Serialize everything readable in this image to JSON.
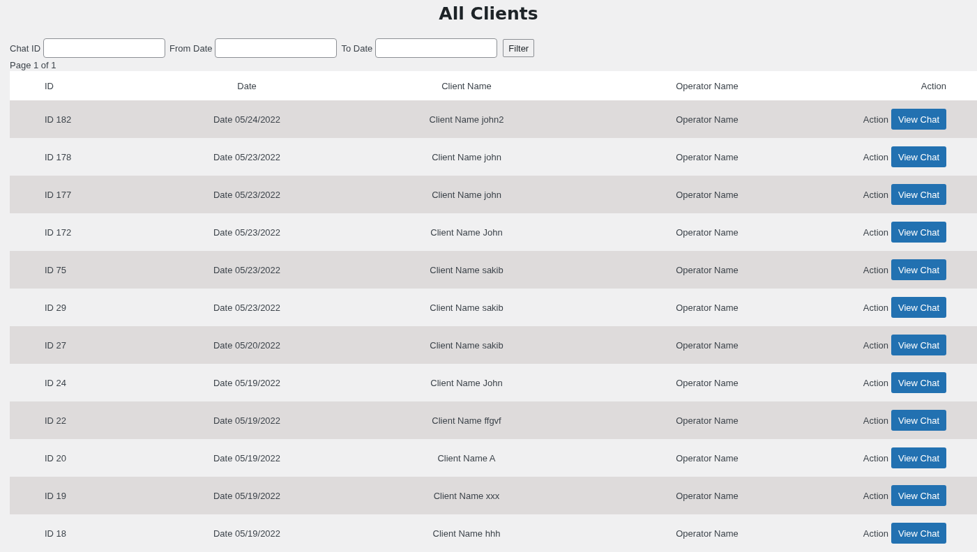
{
  "title": "All Clients",
  "filters": [
    {
      "label": "Chat ID"
    },
    {
      "label": "From Date"
    },
    {
      "label": "To Date"
    }
  ],
  "filter_button": "Filter",
  "page_info": "Page 1 of 1",
  "table": {
    "columns": [
      "ID",
      "Date",
      "Client Name",
      "Operator Name",
      "Action"
    ],
    "rows": [
      {
        "id": "ID 182",
        "date": "Date 05/24/2022",
        "client": "Client Name john2",
        "operator": "Operator Name",
        "action_label": "Action",
        "button": "View Chat"
      },
      {
        "id": "ID 178",
        "date": "Date 05/23/2022",
        "client": "Client Name john",
        "operator": "Operator Name",
        "action_label": "Action",
        "button": "View Chat"
      },
      {
        "id": "ID 177",
        "date": "Date 05/23/2022",
        "client": "Client Name john",
        "operator": "Operator Name",
        "action_label": "Action",
        "button": "View Chat"
      },
      {
        "id": "ID 172",
        "date": "Date 05/23/2022",
        "client": "Client Name John",
        "operator": "Operator Name",
        "action_label": "Action",
        "button": "View Chat"
      },
      {
        "id": "ID 75",
        "date": "Date 05/23/2022",
        "client": "Client Name sakib",
        "operator": "Operator Name",
        "action_label": "Action",
        "button": "View Chat"
      },
      {
        "id": "ID 29",
        "date": "Date 05/23/2022",
        "client": "Client Name sakib",
        "operator": "Operator Name",
        "action_label": "Action",
        "button": "View Chat"
      },
      {
        "id": "ID 27",
        "date": "Date 05/20/2022",
        "client": "Client Name sakib",
        "operator": "Operator Name",
        "action_label": "Action",
        "button": "View Chat"
      },
      {
        "id": "ID 24",
        "date": "Date 05/19/2022",
        "client": "Client Name John",
        "operator": "Operator Name",
        "action_label": "Action",
        "button": "View Chat"
      },
      {
        "id": "ID 22",
        "date": "Date 05/19/2022",
        "client": "Client Name ffgvf",
        "operator": "Operator Name",
        "action_label": "Action",
        "button": "View Chat"
      },
      {
        "id": "ID 20",
        "date": "Date 05/19/2022",
        "client": "Client Name A",
        "operator": "Operator Name",
        "action_label": "Action",
        "button": "View Chat"
      },
      {
        "id": "ID 19",
        "date": "Date 05/19/2022",
        "client": "Client Name xxx",
        "operator": "Operator Name",
        "action_label": "Action",
        "button": "View Chat"
      },
      {
        "id": "ID 18",
        "date": "Date 05/19/2022",
        "client": "Client Name hhh",
        "operator": "Operator Name",
        "action_label": "Action",
        "button": "View Chat"
      }
    ]
  }
}
